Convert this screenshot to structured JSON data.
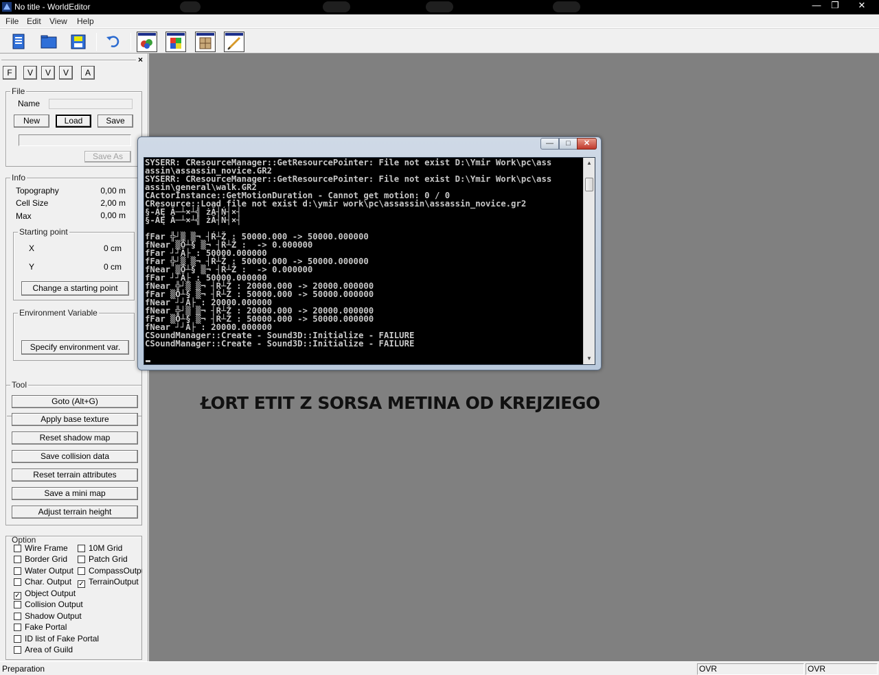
{
  "window": {
    "title": "No title - WorldEditor",
    "min_glyph": "—",
    "max_glyph": "❐",
    "close_glyph": "✕"
  },
  "menu": [
    "File",
    "Edit",
    "View",
    "Help"
  ],
  "toolbar": {
    "buttons": [
      "new-document-icon",
      "open-folder-icon",
      "save-disk-icon",
      "undo-icon",
      "object-mode-icon",
      "texture-mode-icon",
      "attribute-mode-icon",
      "environment-mode-icon"
    ]
  },
  "panel": {
    "close_glyph": "×",
    "mode_buttons": [
      "F",
      "V",
      "V",
      "V",
      "A"
    ],
    "file": {
      "title": "File",
      "name_label": "Name",
      "name_value": "",
      "new_label": "New",
      "load_label": "Load",
      "save_label": "Save",
      "path_value": "",
      "save_as_label": "Save As"
    },
    "info": {
      "title": "Info",
      "rows": [
        {
          "label": "Topography",
          "value": "0,00 m"
        },
        {
          "label": "Cell Size",
          "value": "2,00 m"
        },
        {
          "label": "Max",
          "value": "0,00 m"
        }
      ],
      "starting_point": {
        "title": "Starting point",
        "x_label": "X",
        "x_value": "0 cm",
        "y_label": "Y",
        "y_value": "0 cm",
        "change_label": "Change a starting point"
      },
      "env": {
        "title": "Environment Variable",
        "specify_label": "Specify environment var."
      }
    },
    "tool": {
      "title": "Tool",
      "buttons": [
        "Goto (Alt+G)",
        "Apply base texture",
        "Reset shadow map",
        "Save collision data",
        "Reset terrain attributes",
        "Save a mini map",
        "Adjust terrain height"
      ]
    },
    "option": {
      "title": "Option",
      "check_glyph": "✓",
      "left": [
        {
          "label": "Wire Frame",
          "checked": false
        },
        {
          "label": "Border Grid",
          "checked": false
        },
        {
          "label": "Water Output",
          "checked": false
        },
        {
          "label": "Char. Output",
          "checked": false
        },
        {
          "label": "Object Output",
          "checked": true
        },
        {
          "label": "Collision Output",
          "checked": false
        },
        {
          "label": "Shadow Output",
          "checked": false
        },
        {
          "label": "Fake Portal",
          "checked": false
        },
        {
          "label": "ID list of Fake Portal",
          "checked": false
        },
        {
          "label": "Area of Guild",
          "checked": false
        }
      ],
      "right": [
        {
          "label": "10M Grid",
          "checked": false
        },
        {
          "label": "Patch Grid",
          "checked": false
        },
        {
          "label": "CompassOutput",
          "checked": false
        },
        {
          "label": "TerrainOutput",
          "checked": true
        }
      ]
    }
  },
  "workspace": {
    "caption": "ŁORT ETIT Z SORSA METINA OD KREJZIEGO"
  },
  "console": {
    "min_glyph": "—",
    "max_glyph": "□",
    "close_glyph": "✕",
    "scroll_up": "▲",
    "scroll_down": "▼",
    "lines": [
      "SYSERR: CResourceManager::GetResourcePointer: File not exist D:\\Ymir Work\\pc\\ass",
      "assin\\assassin_novice.GR2",
      "SYSERR: CResourceManager::GetResourcePointer: File not exist D:\\Ymir Work\\pc\\ass",
      "assin\\general\\walk.GR2",
      "CActorInstance::GetMotionDuration - Cannot get motion: 0 / 0",
      "CResource::Load file not exist d:\\ymir work\\pc\\assassin\\assassin_novice.gr2",
      "§-ÁĘ Ă─┴×┴╣ żĂ┤Ń┤×┤",
      "§-ÁĘ Ă─┴×┴╣ żĂ┤Ń┤×┤",
      "",
      "fFar ╬┘▒ ▒¬ ┤Ŕ┴Ž : 50000.000 -> 50000.000000",
      "fNear ▒Ô┴§ ▒¬ ┤Ŕ┴Ž :  -> 0.000000",
      "fFar ┘┘Ă├ : 50000.000000",
      "fFar ╬┘▒ ▒¬ ┤Ŕ┴Ž : 50000.000 -> 50000.000000",
      "fNear ▒Ô┴§ ▒¬ ┤Ŕ┴Ž :  -> 0.000000",
      "fFar ┘┘Ă├ : 50000.000000",
      "fNear ╬┘▒ ▒¬ ┤Ŕ┴Ž : 20000.000 -> 20000.000000",
      "fFar ▒Ô┴§ ▒¬ ┤Ŕ┴Ž : 50000.000 -> 50000.000000",
      "fNear ┘┘Ă├ : 20000.000000",
      "fNear ╬┘▒ ▒¬ ┤Ŕ┴Ž : 20000.000 -> 20000.000000",
      "fFar ▒Ô┴§ ▒¬ ┤Ŕ┴Ž : 50000.000 -> 50000.000000",
      "fNear ┘┘Ă├ : 20000.000000",
      "CSoundManager::Create - Sound3D::Initialize - FAILURE",
      "CSoundManager::Create - Sound3D::Initialize - FAILURE"
    ]
  },
  "statusbar": {
    "text": "Preparation",
    "pane1": "OVR",
    "pane2": "OVR"
  }
}
